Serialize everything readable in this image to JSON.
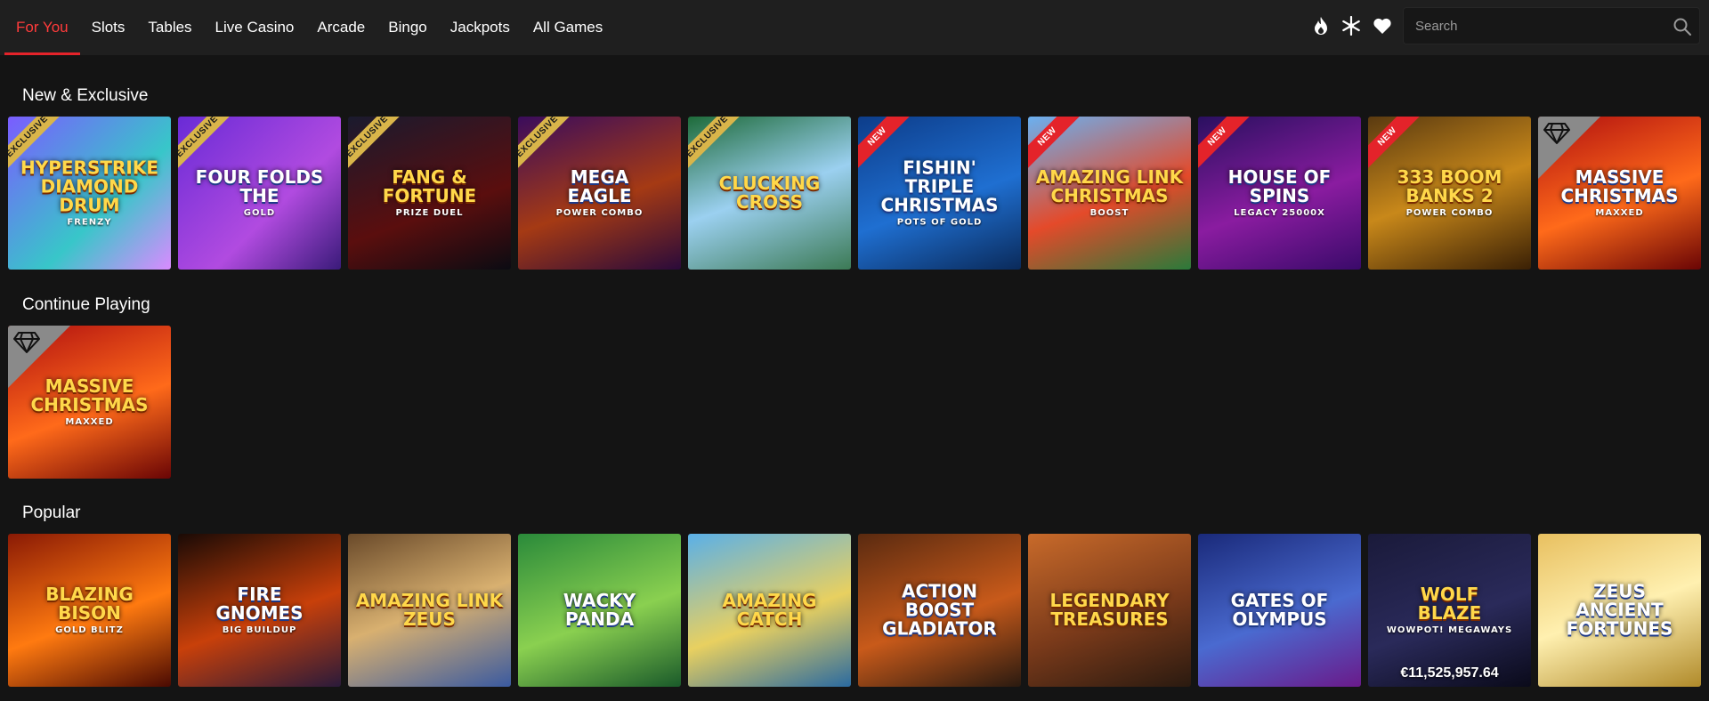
{
  "nav": {
    "items": [
      {
        "label": "For You",
        "active": true
      },
      {
        "label": "Slots"
      },
      {
        "label": "Tables"
      },
      {
        "label": "Live Casino"
      },
      {
        "label": "Arcade"
      },
      {
        "label": "Bingo"
      },
      {
        "label": "Jackpots"
      },
      {
        "label": "All Games"
      }
    ],
    "icons": [
      "flame-icon",
      "snowflake-icon",
      "heart-icon"
    ],
    "accent_color": "#e4232a"
  },
  "search": {
    "placeholder": "Search",
    "value": ""
  },
  "sections": [
    {
      "title": "New & Exclusive",
      "games": [
        {
          "badge": "EXCLUSIVE",
          "art_lines": [
            "Hyperstrike",
            "Diamond Drum",
            "Frenzy"
          ]
        },
        {
          "badge": "EXCLUSIVE",
          "art_lines": [
            "Four Folds",
            "The",
            "Gold"
          ]
        },
        {
          "badge": "EXCLUSIVE",
          "art_lines": [
            "Fang &",
            "Fortune",
            "Prize Duel"
          ]
        },
        {
          "badge": "EXCLUSIVE",
          "art_lines": [
            "Mega",
            "Eagle",
            "Power Combo"
          ]
        },
        {
          "badge": "EXCLUSIVE",
          "art_lines": [
            "Clucking",
            "Cross",
            ""
          ]
        },
        {
          "badge": "NEW",
          "art_lines": [
            "Fishin' Triple",
            "Christmas",
            "Pots of Gold"
          ]
        },
        {
          "badge": "NEW",
          "art_lines": [
            "Amazing Link",
            "Christmas",
            "Boost"
          ]
        },
        {
          "badge": "NEW",
          "art_lines": [
            "House of",
            "Spins",
            "Legacy 25000x"
          ]
        },
        {
          "badge": "NEW",
          "art_lines": [
            "333 Boom",
            "Banks 2",
            "Power Combo"
          ]
        },
        {
          "badge": "GEM",
          "art_lines": [
            "Massive",
            "Christmas",
            "Maxxed"
          ]
        }
      ]
    },
    {
      "title": "Continue Playing",
      "games": [
        {
          "badge": "GEM",
          "art_lines": [
            "Massive",
            "Christmas",
            "Maxxed"
          ]
        }
      ]
    },
    {
      "title": "Popular",
      "games": [
        {
          "art_lines": [
            "Blazing",
            "Bison",
            "Gold Blitz"
          ]
        },
        {
          "art_lines": [
            "Fire",
            "Gnomes",
            "Big Buildup"
          ]
        },
        {
          "art_lines": [
            "Amazing Link",
            "Zeus",
            ""
          ]
        },
        {
          "art_lines": [
            "Wacky",
            "Panda",
            ""
          ]
        },
        {
          "art_lines": [
            "Amazing",
            "Catch",
            ""
          ]
        },
        {
          "art_lines": [
            "Action Boost",
            "Gladiator",
            ""
          ]
        },
        {
          "art_lines": [
            "Legendary",
            "Treasures",
            ""
          ]
        },
        {
          "art_lines": [
            "Gates of",
            "Olympus",
            ""
          ]
        },
        {
          "art_lines": [
            "Wolf",
            "Blaze",
            "WowPot! Megaways"
          ],
          "jackpot": "€11,525,957.64"
        },
        {
          "art_lines": [
            "Zeus",
            "Ancient Fortunes",
            ""
          ]
        }
      ]
    }
  ]
}
